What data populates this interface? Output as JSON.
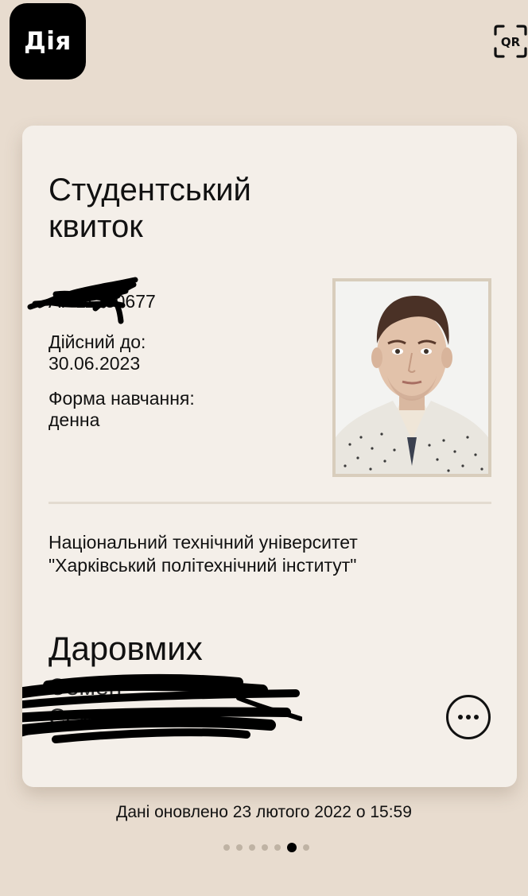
{
  "app": {
    "logo_text": "Дія",
    "qr_label": "QR"
  },
  "card": {
    "title": "Студентський квиток",
    "number": "АГ 11230677",
    "valid_until_label": "Дійсний до:",
    "valid_until_value": "30.06.2023",
    "study_form_label": "Форма навчання:",
    "study_form_value": "денна",
    "university_line1": "Національний технічний університет",
    "university_line2": "\"Харківський політехнічний інститут\"",
    "surname": "Даровмих",
    "given_name": "Семен",
    "patronymic": "Семенович"
  },
  "footer": {
    "updated_text": "Дані оновлено 23 лютого 2022 о 15:59"
  },
  "pager": {
    "count": 7,
    "active_index": 5
  },
  "colors": {
    "background": "#e8dccf",
    "card": "#f4efe9",
    "accent": "#000000"
  }
}
